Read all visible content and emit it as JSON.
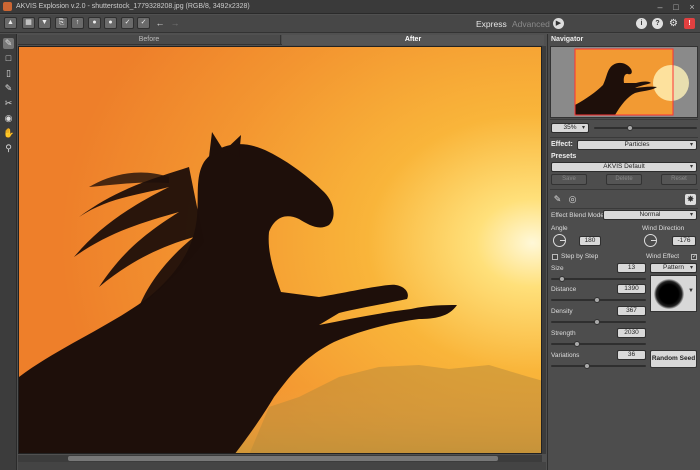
{
  "window": {
    "title": "AKVIS Explosion v.2.0 - shutterstock_1779328208.jpg (RGB/8, 3492x2328)"
  },
  "toolbar": {
    "mode_express": "Express",
    "mode_advanced": "Advanced"
  },
  "canvas": {
    "tab_before": "Before",
    "tab_after": "After",
    "colors": {
      "sky_top": "#f08a2c",
      "sky_mid": "#f6a43a",
      "sun": "#fff6cf",
      "silhouette": "#1e0f0a"
    }
  },
  "navigator": {
    "title": "Navigator",
    "zoom": "35%"
  },
  "effect": {
    "label": "Effect:",
    "value": "Particles"
  },
  "presets": {
    "label": "Presets",
    "value": "AKVIS Default",
    "save": "Save",
    "delete": "Delete",
    "reset": "Reset"
  },
  "params": {
    "blend_label": "Effect Blend Mode",
    "blend_value": "Normal",
    "angle_label": "Angle",
    "angle_value": "180",
    "wind_dir_label": "Wind Direction",
    "wind_dir_value": "-176",
    "step_by_step": "Step by Step",
    "wind_effect": "Wind Effect",
    "size_label": "Size",
    "size_value": "13",
    "pattern_label": "Pattern",
    "distance_label": "Distance",
    "distance_value": "1390",
    "density_label": "Density",
    "density_value": "367",
    "strength_label": "Strength",
    "strength_value": "2030",
    "variations_label": "Variations",
    "variations_value": "36",
    "random_seed": "Random Seed"
  },
  "accent": "#e04040"
}
